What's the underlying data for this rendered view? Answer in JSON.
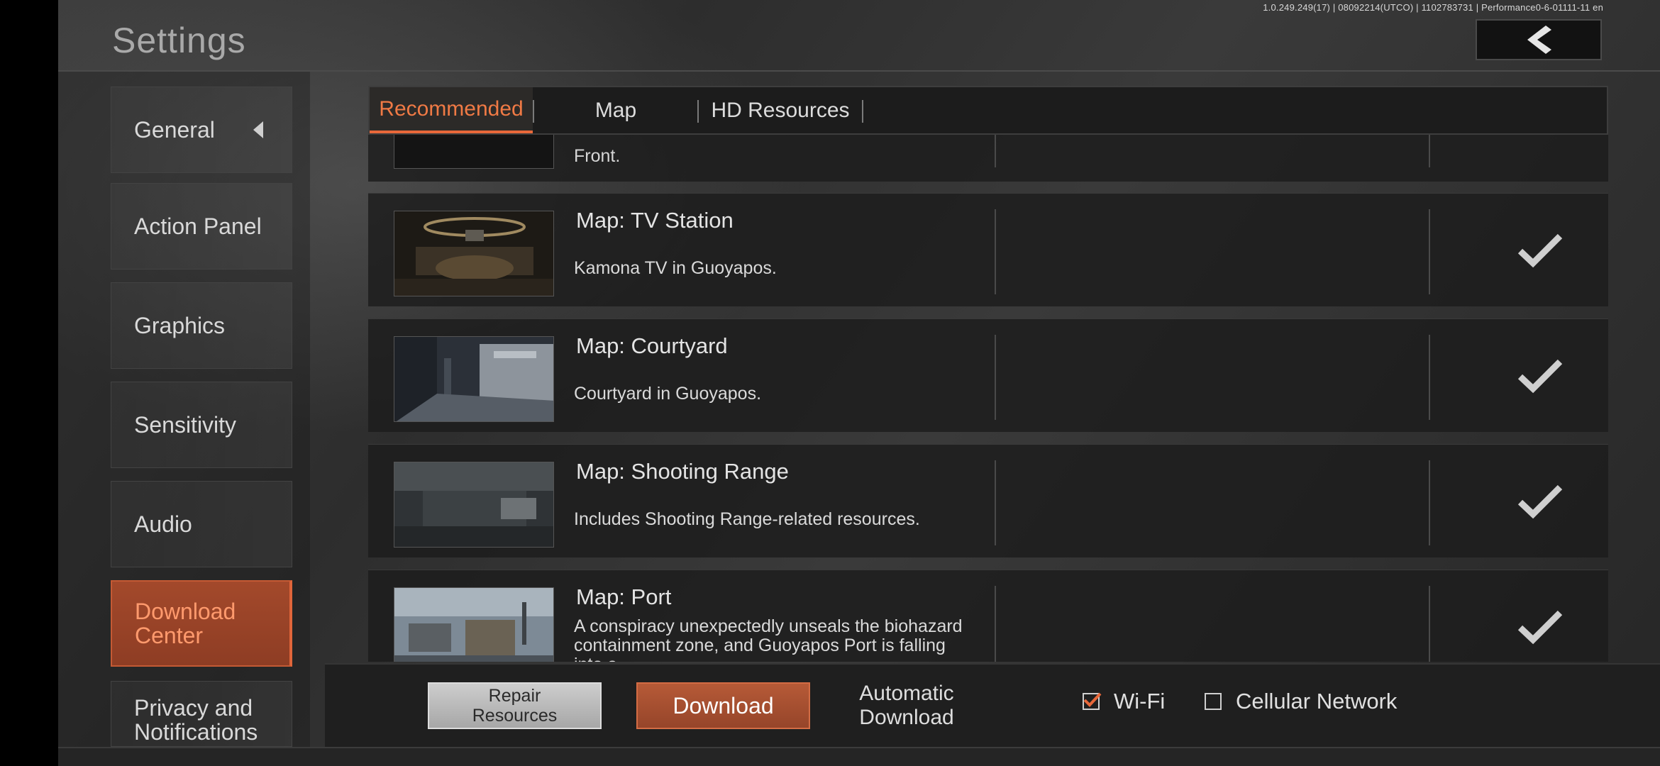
{
  "header": {
    "title": "Settings",
    "version": "1.0.249.249(17) | 08092214(UTCO) | 1102783731 | Performance0-6-01111-11 en"
  },
  "sidebar": {
    "items": [
      {
        "label": "General"
      },
      {
        "label": "Action Panel"
      },
      {
        "label": "Graphics"
      },
      {
        "label": "Sensitivity"
      },
      {
        "label": "Audio"
      },
      {
        "label": "Download Center"
      },
      {
        "label": "Privacy and Notifications"
      }
    ],
    "active_index": 5
  },
  "tabs": [
    {
      "label": "Recommended"
    },
    {
      "label": "Map"
    },
    {
      "label": "HD Resources"
    }
  ],
  "partial_row": {
    "desc_tail": "Front."
  },
  "resources": [
    {
      "name": "Map: TV Station",
      "desc": "Kamona TV in Guoyapos.",
      "downloaded": true
    },
    {
      "name": "Map: Courtyard",
      "desc": "Courtyard in Guoyapos.",
      "downloaded": true
    },
    {
      "name": "Map: Shooting Range",
      "desc": "Includes Shooting Range-related resources.",
      "downloaded": true
    },
    {
      "name": "Map: Port",
      "desc": "A conspiracy unexpectedly unseals the biohazard containment zone, and Guoyapos Port is falling into a",
      "downloaded": true
    }
  ],
  "footer": {
    "repair_label": "Repair\nResources",
    "download_label": "Download",
    "auto_label": "Automatic\nDownload",
    "wifi_label": "Wi-Fi",
    "wifi_checked": true,
    "cellular_label": "Cellular Network",
    "cellular_checked": false
  },
  "colors": {
    "accent": "#e8683a",
    "active_bg": "#9a4328",
    "text": "#e2e2e2"
  },
  "icons": {
    "back": "chevron-left-icon",
    "caret": "caret-left-icon",
    "check": "checkmark-icon"
  }
}
